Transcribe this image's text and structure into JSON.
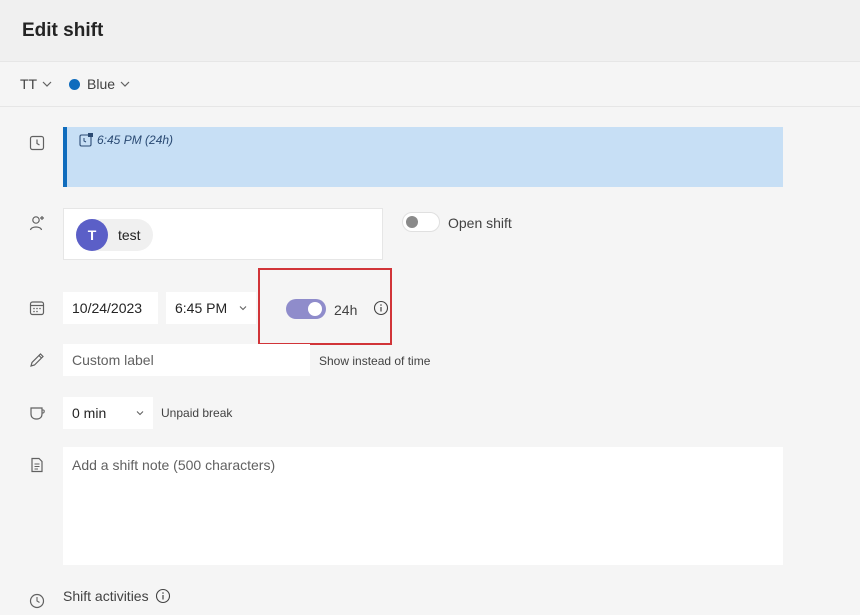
{
  "header": {
    "title": "Edit shift"
  },
  "toolbar": {
    "tag": "TT",
    "color_name": "Blue",
    "color_hex": "#0f6cbd"
  },
  "preview": {
    "text": "6:45 PM (24h)"
  },
  "member": {
    "initial": "T",
    "name": "test"
  },
  "open_shift": {
    "label": "Open shift",
    "enabled": false
  },
  "schedule": {
    "date": "10/24/2023",
    "time": "6:45 PM",
    "toggle_label": "24h",
    "toggle_on": true
  },
  "custom_label": {
    "placeholder": "Custom label",
    "hint": "Show instead of time"
  },
  "break": {
    "value": "0 min",
    "label": "Unpaid break"
  },
  "note": {
    "placeholder": "Add a shift note (500 characters)"
  },
  "activities": {
    "label": "Shift activities"
  }
}
